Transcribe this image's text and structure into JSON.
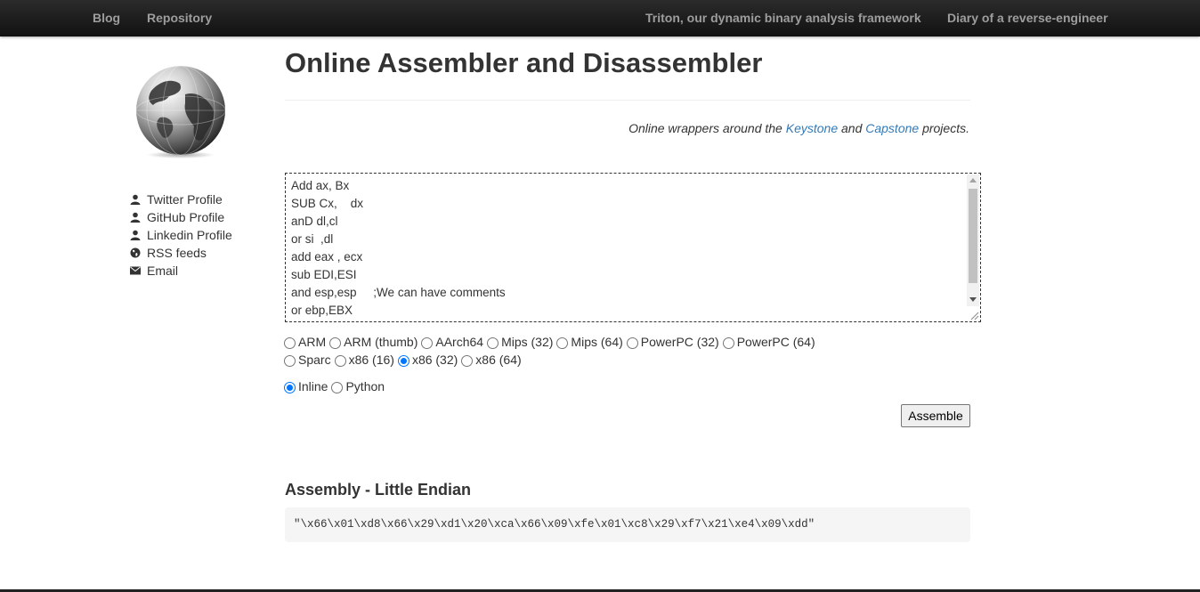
{
  "nav": {
    "left": [
      "Blog",
      "Repository"
    ],
    "right": [
      "Triton, our dynamic binary analysis framework",
      "Diary of a reverse-engineer"
    ]
  },
  "sidebar": {
    "links": [
      {
        "label": "Twitter Profile",
        "icon": "user-icon"
      },
      {
        "label": "GitHub Profile",
        "icon": "user-icon"
      },
      {
        "label": "Linkedin Profile",
        "icon": "user-icon"
      },
      {
        "label": "RSS feeds",
        "icon": "globe-icon"
      },
      {
        "label": "Email",
        "icon": "envelope-icon"
      }
    ]
  },
  "header": {
    "title": "Online Assembler and Disassembler",
    "subtitle_before": "Online wrappers around the ",
    "link1": "Keystone",
    "subtitle_mid": " and ",
    "link2": "Capstone",
    "subtitle_after": " projects."
  },
  "editor": {
    "lines": [
      "Add ax, Bx",
      "SUB Cx,    dx",
      "anD dl,cl",
      "or si  ,dl",
      "add eax , ecx",
      "sub EDI,ESI",
      "and esp,esp     ;We can have comments",
      "or ebp,EBX"
    ]
  },
  "architectures": {
    "row1": [
      {
        "label": "ARM",
        "checked": false
      },
      {
        "label": "ARM (thumb)",
        "checked": false
      },
      {
        "label": "AArch64",
        "checked": false
      },
      {
        "label": "Mips (32)",
        "checked": false
      },
      {
        "label": "Mips (64)",
        "checked": false
      },
      {
        "label": "PowerPC (32)",
        "checked": false
      },
      {
        "label": "PowerPC (64)",
        "checked": false
      }
    ],
    "row2": [
      {
        "label": "Sparc",
        "checked": false
      },
      {
        "label": "x86 (16)",
        "checked": false
      },
      {
        "label": "x86 (32)",
        "checked": true
      },
      {
        "label": "x86 (64)",
        "checked": false
      }
    ]
  },
  "format": [
    {
      "label": "Inline",
      "checked": true
    },
    {
      "label": "Python",
      "checked": false
    }
  ],
  "assemble_label": "Assemble",
  "result": {
    "title": "Assembly - Little Endian",
    "output": "\"\\x66\\x01\\xd8\\x66\\x29\\xd1\\x20\\xca\\x66\\x09\\xfe\\x01\\xc8\\x29\\xf7\\x21\\xe4\\x09\\xdd\""
  },
  "colors": {
    "link": "#337ab7",
    "radio_selected": "#0075ff",
    "navbar": "#1b1b1b"
  }
}
